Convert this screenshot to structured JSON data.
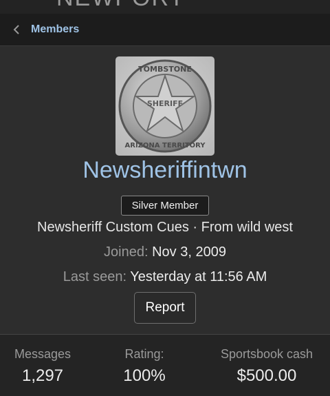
{
  "header": {
    "logo_fragment": "NEWPORT"
  },
  "breadcrumb": {
    "label": "Members"
  },
  "profile": {
    "avatar_alt": "TOMBSTONE SHERIFF ARIZONA TERRITORY",
    "avatar_text_top": "TOMBSTONE",
    "avatar_text_center": "SHERIFF",
    "avatar_text_bottom": "ARIZONA TERRITORY",
    "username": "Newsheriffintwn",
    "badge": "Silver Member",
    "tagline": "Newsheriff Custom Cues · From wild west",
    "joined_label": "Joined:",
    "joined_value": "Nov 3, 2009",
    "last_seen_label": "Last seen:",
    "last_seen_value": "Yesterday at 11:56 AM",
    "report_label": "Report"
  },
  "stats": [
    {
      "label": "Messages",
      "value": "1,297"
    },
    {
      "label": "Rating:",
      "value": "100%"
    },
    {
      "label": "Sportsbook cash",
      "value": "$500.00"
    }
  ],
  "colors": {
    "background": "#2d2d2d",
    "accent_link": "#9fc3e6",
    "stats_bg": "#242424"
  }
}
